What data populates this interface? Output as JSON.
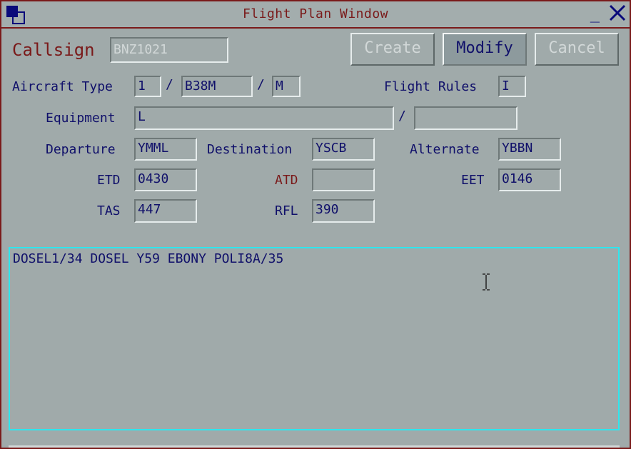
{
  "window": {
    "title": "Flight Plan Window",
    "min_label": "_",
    "icons": [
      "window-menu-icon",
      "minimize-icon",
      "close-icon"
    ]
  },
  "toolbar": {
    "create_label": "Create",
    "modify_label": "Modify",
    "cancel_label": "Cancel"
  },
  "callsign": {
    "label": "Callsign",
    "value": "BNZ1021"
  },
  "aircraft": {
    "label": "Aircraft Type",
    "count": "1",
    "type": "B38M",
    "wake": "M",
    "sep": "/"
  },
  "flight_rules": {
    "label": "Flight Rules",
    "value": "I"
  },
  "equipment": {
    "label": "Equipment",
    "value": "L",
    "value2": "",
    "sep": "/"
  },
  "departure": {
    "label": "Departure",
    "value": "YMML"
  },
  "destination": {
    "label": "Destination",
    "value": "YSCB"
  },
  "alternate": {
    "label": "Alternate",
    "value": "YBBN"
  },
  "etd": {
    "label": "ETD",
    "value": "0430"
  },
  "atd": {
    "label": "ATD",
    "value": ""
  },
  "eet": {
    "label": "EET",
    "value": "0146"
  },
  "tas": {
    "label": "TAS",
    "value": "447"
  },
  "rfl": {
    "label": "RFL",
    "value": "390"
  },
  "route": {
    "text": "DOSEL1/34 DOSEL Y59 EBONY POLI8A/35"
  },
  "colors": {
    "background": "#a0aaaa",
    "text": "#10106a",
    "label_red": "#7a1a1a",
    "route_border": "#2ee6ee",
    "disabled_text": "#d2d8d8"
  }
}
